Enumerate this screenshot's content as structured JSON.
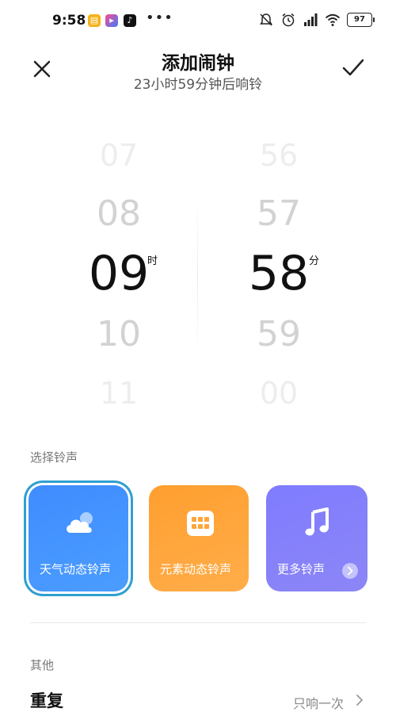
{
  "status_bar": {
    "time": "9:58",
    "battery": "97"
  },
  "header": {
    "title": "添加闹钟",
    "subtitle": "23小时59分钟后响铃"
  },
  "picker": {
    "hours": [
      "07",
      "08",
      "09",
      "10",
      "11"
    ],
    "minutes": [
      "56",
      "57",
      "58",
      "59",
      "00"
    ],
    "hour_unit": "时",
    "minute_unit": "分",
    "selected_hour": "09",
    "selected_minute": "58"
  },
  "ringtone": {
    "section_label": "选择铃声",
    "options": [
      {
        "label": "天气动态铃声",
        "icon": "cloud-icon",
        "color": "#3f8cff"
      },
      {
        "label": "元素动态铃声",
        "icon": "grid-icon",
        "color": "#ff9f2f"
      },
      {
        "label": "更多铃声",
        "icon": "music-note-icon",
        "color": "#7f7cff"
      }
    ]
  },
  "other": {
    "section_label": "其他",
    "repeat_title": "重复",
    "repeat_value": "只响一次"
  }
}
